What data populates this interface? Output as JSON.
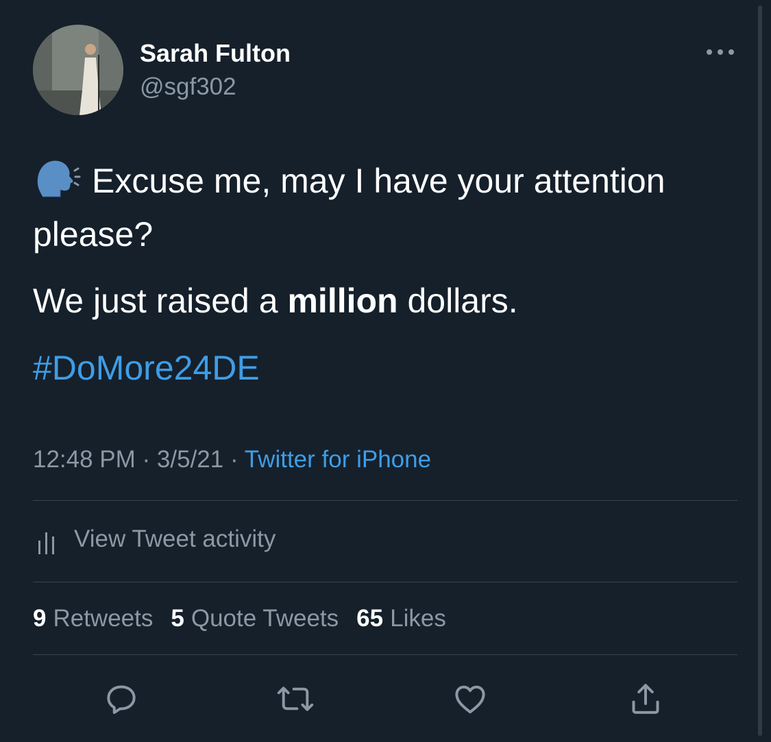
{
  "author": {
    "name": "Sarah Fulton",
    "handle": "@sgf302"
  },
  "tweet": {
    "emoji": "speaking-head-emoji",
    "line1": "Excuse me, may I have your attention please?",
    "line2_pre": "We just raised a ",
    "line2_bold": "million",
    "line2_post": " dollars.",
    "hashtag": "#DoMore24DE"
  },
  "meta": {
    "time": "12:48 PM",
    "separator": " · ",
    "date": "3/5/21",
    "source": "Twitter for iPhone"
  },
  "activity": {
    "label": "View Tweet activity"
  },
  "stats": {
    "retweets_count": "9",
    "retweets_label": "Retweets",
    "quotes_count": "5",
    "quotes_label": "Quote Tweets",
    "likes_count": "65",
    "likes_label": "Likes"
  },
  "colors": {
    "background": "#15202b",
    "secondary_text": "#8b98a5",
    "link": "#3f9de6",
    "divider": "#38444d"
  },
  "icons": {
    "more": "more-horizontal-icon",
    "activity": "bar-chart-icon",
    "reply": "reply-icon",
    "retweet": "retweet-icon",
    "like": "heart-icon",
    "share": "share-icon"
  }
}
